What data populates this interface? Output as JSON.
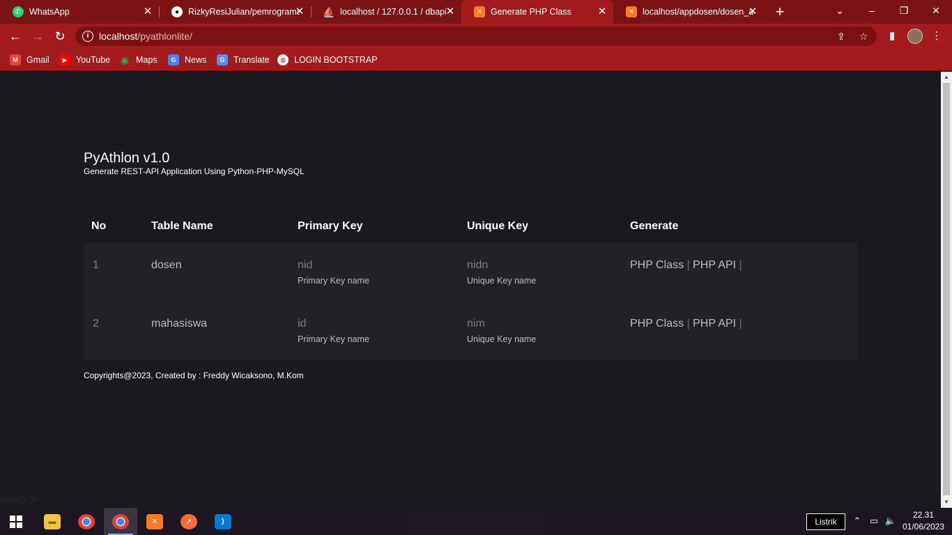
{
  "browser": {
    "tabs": [
      {
        "title": "WhatsApp",
        "icon": "whatsapp-icon"
      },
      {
        "title": "RizkyResiJulian/pemrograman",
        "icon": "github-icon"
      },
      {
        "title": "localhost / 127.0.0.1 / dbapi /",
        "icon": "phpmyadmin-icon"
      },
      {
        "title": "Generate PHP Class",
        "icon": "xampp-icon",
        "active": true
      },
      {
        "title": "localhost/appdosen/dosen_a",
        "icon": "xampp-icon"
      }
    ],
    "address": {
      "host": "localhost",
      "path": "/pyathlonlite/"
    },
    "bookmarks": [
      {
        "label": "Gmail",
        "icon": "gmail-icon"
      },
      {
        "label": "YouTube",
        "icon": "youtube-icon"
      },
      {
        "label": "Maps",
        "icon": "maps-icon"
      },
      {
        "label": "News",
        "icon": "news-icon"
      },
      {
        "label": "Translate",
        "icon": "translate-icon"
      },
      {
        "label": "LOGIN BOOTSTRAP",
        "icon": "globe-icon"
      }
    ],
    "colors": {
      "frame": "#7a1216",
      "toolbar": "#a11b1f"
    }
  },
  "page": {
    "title": "PyAthlon v1.0",
    "subtitle": "Generate REST-API Application Using Python-PHP-MySQL",
    "table": {
      "headers": [
        "No",
        "Table Name",
        "Primary Key",
        "Unique Key",
        "Generate"
      ],
      "rows": [
        {
          "no": "1",
          "table_name": "dosen",
          "primary_key": "nid",
          "primary_key_sub": "Primary Key name",
          "unique_key": "nidn",
          "unique_key_sub": "Unique Key name",
          "gen_class": "PHP Class",
          "gen_api": "PHP API"
        },
        {
          "no": "2",
          "table_name": "mahasiswa",
          "primary_key": "id",
          "primary_key_sub": "Primary Key name",
          "unique_key": "nim",
          "unique_key_sub": "Unique Key name",
          "gen_class": "PHP Class",
          "gen_api": "PHP API"
        }
      ],
      "separator": "|"
    },
    "footer": "Copyrights@2023, Created by : Freddy Wicaksono, M.Kom",
    "stray_text": "close(); ?>",
    "colors": {
      "background": "#1a191d",
      "row_background": "#222226"
    }
  },
  "taskbar": {
    "apps": [
      "file-explorer-icon",
      "chrome-icon",
      "chrome-profile-icon",
      "xampp-icon",
      "postman-icon",
      "vscode-icon"
    ],
    "tray_label": "Listrik",
    "time": "22.31",
    "date": "01/06/2023"
  }
}
